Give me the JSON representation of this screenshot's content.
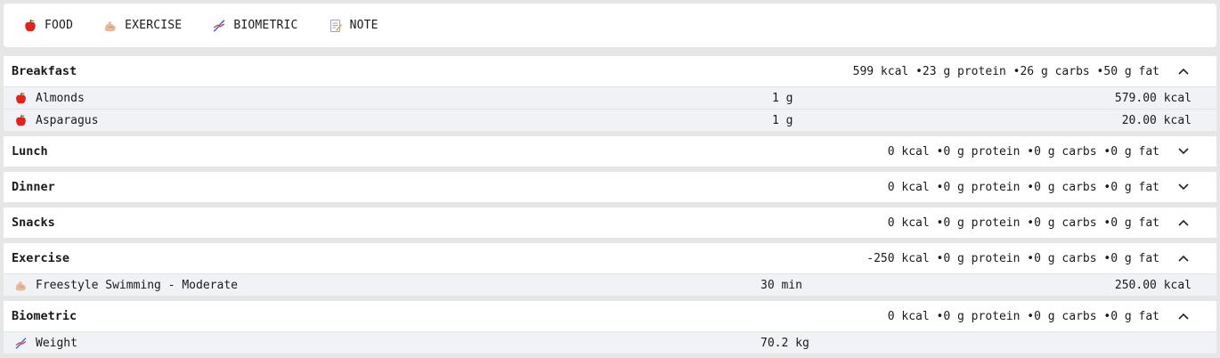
{
  "toolbar": {
    "buttons": [
      {
        "label": "FOOD",
        "icon": "apple-icon"
      },
      {
        "label": "EXERCISE",
        "icon": "flexed-arm-icon"
      },
      {
        "label": "BIOMETRIC",
        "icon": "dna-icon"
      },
      {
        "label": "NOTE",
        "icon": "memo-icon"
      }
    ]
  },
  "sections": {
    "breakfast": {
      "title": "Breakfast",
      "summary": "599 kcal •23 g protein •26 g carbs •50 g fat",
      "expanded": true,
      "items": [
        {
          "name": "Almonds",
          "qty": "1 g",
          "kcal": "579.00 kcal",
          "icon": "apple-icon"
        },
        {
          "name": "Asparagus",
          "qty": "1 g",
          "kcal": "20.00 kcal",
          "icon": "apple-icon"
        }
      ]
    },
    "lunch": {
      "title": "Lunch",
      "summary": "0 kcal •0 g protein •0 g carbs •0 g fat",
      "expanded": false
    },
    "dinner": {
      "title": "Dinner",
      "summary": "0 kcal •0 g protein •0 g carbs •0 g fat",
      "expanded": false
    },
    "snacks": {
      "title": "Snacks",
      "summary": "0 kcal •0 g protein •0 g carbs •0 g fat",
      "expanded": true
    },
    "exercise": {
      "title": "Exercise",
      "summary": "-250 kcal •0 g protein •0 g carbs •0 g fat",
      "expanded": true,
      "items": [
        {
          "name": "Freestyle Swimming - Moderate",
          "qty": "30 min",
          "kcal": "250.00 kcal",
          "icon": "flexed-arm-icon"
        }
      ]
    },
    "biometric": {
      "title": "Biometric",
      "summary": "0 kcal •0 g protein •0 g carbs •0 g fat",
      "expanded": true,
      "items": [
        {
          "name": "Weight",
          "qty": "70.2 kg",
          "icon": "dna-icon"
        }
      ]
    }
  },
  "colors": {
    "background": "#e6e6e6",
    "panel": "#ffffff",
    "row": "#f0f2f5",
    "apple": "#e0241b",
    "arm": "#e8b99a",
    "dna_blue": "#3b6fd8",
    "dna_red": "#d9443a"
  }
}
